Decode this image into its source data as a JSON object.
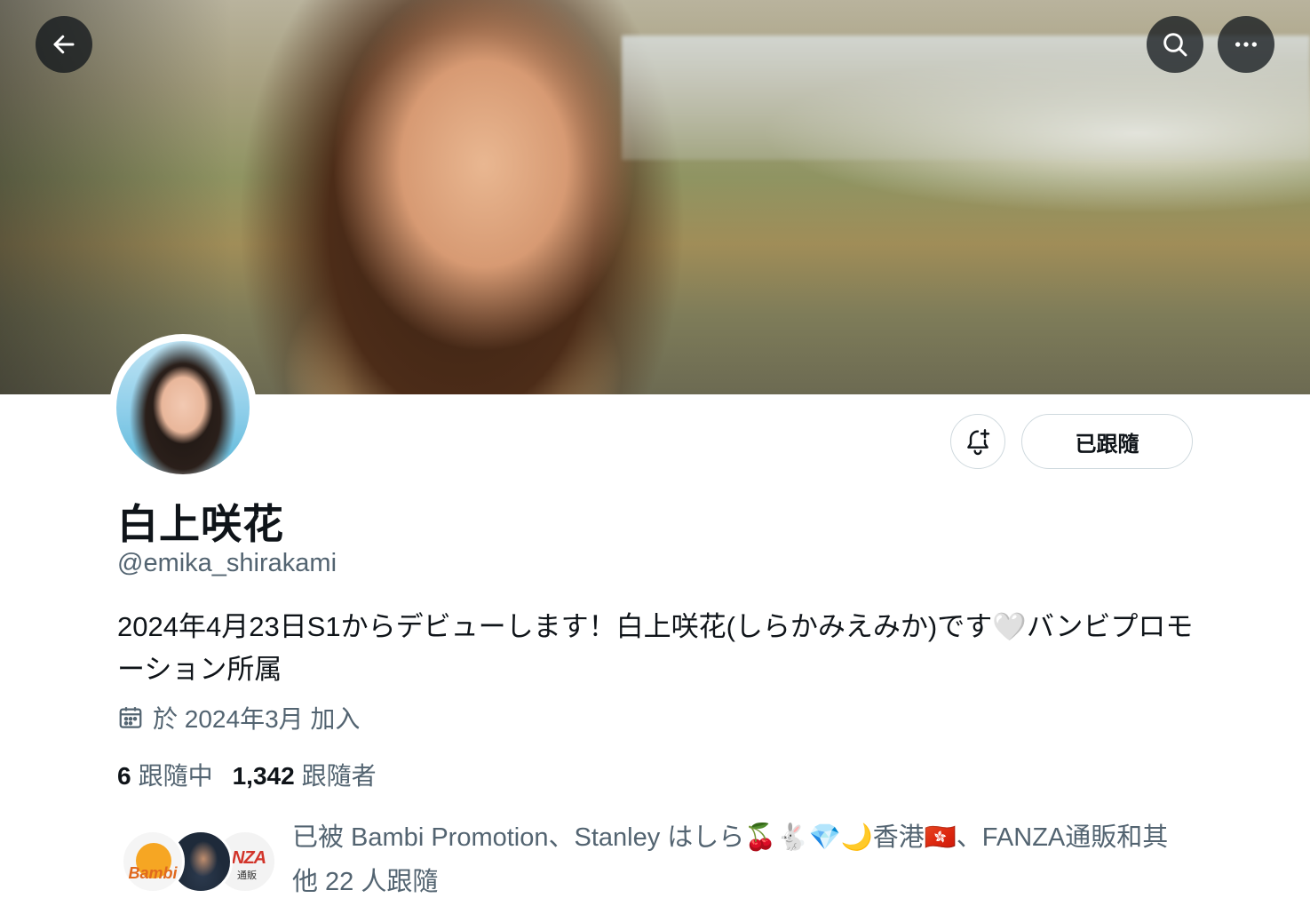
{
  "header": {
    "back_icon": "arrow-left-icon",
    "search_icon": "search-icon",
    "more_icon": "more-horizontal-icon"
  },
  "profile": {
    "display_name": "白上咲花",
    "handle": "@emika_shirakami",
    "bio": "2024年4月23日S1からデビューします！白上咲花(しらかみえみか)です🤍バンビプロモーション所属",
    "joined": "於 2024年3月 加入",
    "following_count": "6",
    "following_label": "跟隨中",
    "followers_count": "1,342",
    "followers_label": "跟隨者"
  },
  "actions": {
    "notify_icon": "bell-plus-icon",
    "follow_button_label": "已跟隨"
  },
  "followed_by": {
    "text": "已被 Bambi Promotion、Stanley はしら🍒🐇💎🌙香港🇭🇰、FANZA通販和其他 22 人跟隨",
    "avatar_1_label": "Bambi",
    "avatar_3_label": "NZA",
    "avatar_3_sublabel": "通販"
  },
  "colors": {
    "text_primary": "#0f1419",
    "text_secondary": "#536471",
    "border": "#cfd9de"
  }
}
